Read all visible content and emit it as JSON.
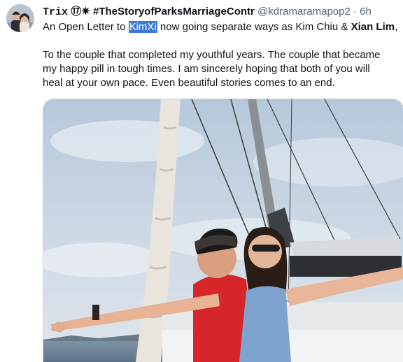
{
  "tweet": {
    "author": {
      "name_prefix": "Trix",
      "name_badge": "⑰",
      "name_star": "✷",
      "name_tag": "#TheStoryofParksMarriageContr",
      "handle": "@kdramaramapop2",
      "separator": "·",
      "time": "6h"
    },
    "text": {
      "l1_a": "An Open Letter to ",
      "l1_highlight": "KimXi",
      "l1_b": " now going separate ways as Kim Chiu & ",
      "l1_bold": "Xian Lim",
      "l1_c": ",",
      "l2": "To the couple that completed my youthful years. The couple that became",
      "l3": "my happy pill in tough times. I am sincerely hoping that both of you will",
      "l4": "heal at your own pace. Even beautiful stories comes to an end."
    },
    "media": {
      "icon": "photo-of-couple-on-sailboat"
    }
  },
  "colors": {
    "text": "#0f1419",
    "secondary": "#536471",
    "highlight": "#3c78d8",
    "border": "#cfd9de"
  }
}
